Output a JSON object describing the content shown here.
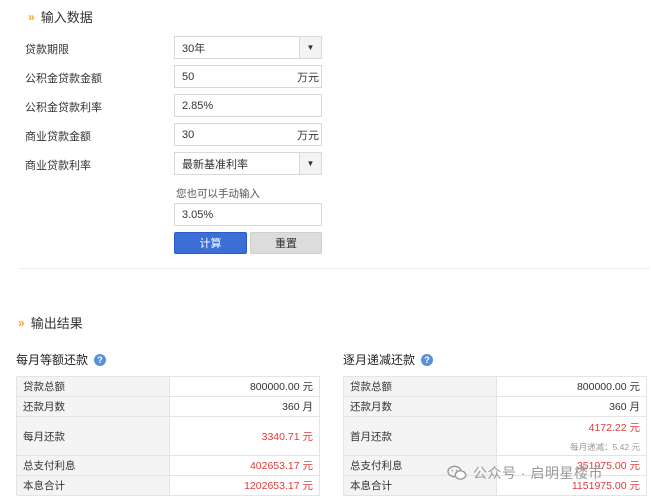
{
  "input": {
    "title": "输入数据",
    "fields": [
      {
        "label": "贷款期限",
        "value": "30年",
        "type": "select"
      },
      {
        "label": "公积金贷款金额",
        "value": "50",
        "unit": "万元"
      },
      {
        "label": "公积金贷款利率",
        "value": "2.85%"
      },
      {
        "label": "商业贷款金额",
        "value": "30",
        "unit": "万元"
      },
      {
        "label": "商业贷款利率",
        "value": "最新基准利率",
        "type": "select"
      }
    ],
    "hint": "您也可以手动输入",
    "manual_rate": "3.05%",
    "calc_label": "计算",
    "reset_label": "重置"
  },
  "output": {
    "title": "输出结果",
    "equal_payment": {
      "title": "每月等额还款",
      "rows": [
        {
          "label": "贷款总额",
          "value": "800000.00 元"
        },
        {
          "label": "还款月数",
          "value": "360 月"
        },
        {
          "label": "每月还款",
          "value": "3340.71 元"
        },
        {
          "label": "总支付利息",
          "value": "402653.17 元"
        },
        {
          "label": "本息合计",
          "value": "1202653.17 元"
        }
      ]
    },
    "equal_principal": {
      "title": "逐月递减还款",
      "rows": [
        {
          "label": "贷款总额",
          "value": "800000.00 元"
        },
        {
          "label": "还款月数",
          "value": "360 月"
        },
        {
          "label": "首月还款",
          "value": "4172.22 元",
          "note": "每月递减：5.42 元"
        },
        {
          "label": "总支付利息",
          "value": "351975.00 元"
        },
        {
          "label": "本息合计",
          "value": "1151975.00 元"
        }
      ]
    }
  },
  "watermark": "公众号 · 启明星楼市",
  "colors": {
    "accent": "#3b6fd6",
    "highlight": "#e23a3a",
    "chevron": "#f5a623"
  }
}
